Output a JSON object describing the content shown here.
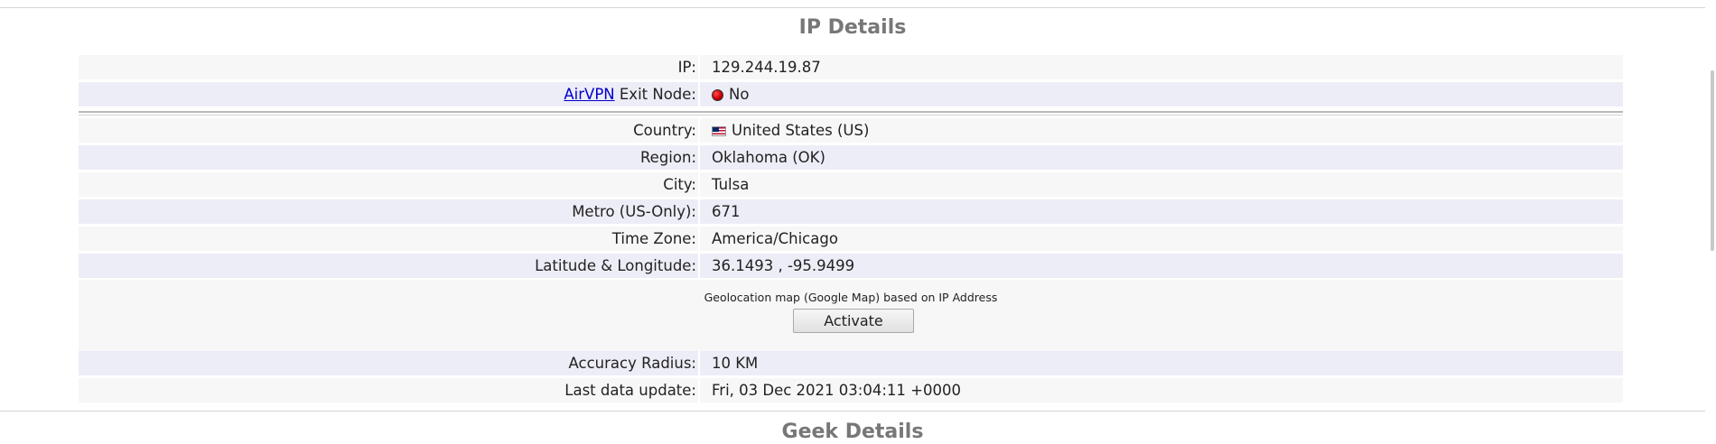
{
  "sections": {
    "ip_details_title": "IP Details",
    "geek_details_title": "Geek Details"
  },
  "rows": {
    "ip": {
      "label": "IP:",
      "value": "129.244.19.87"
    },
    "exit_node": {
      "link": "AirVPN",
      "label": " Exit Node:",
      "value": "No",
      "status_icon": "red-dot-icon"
    },
    "country": {
      "label": "Country:",
      "value": "United States (US)",
      "flag_icon": "us-flag-icon"
    },
    "region": {
      "label": "Region:",
      "value": "Oklahoma (OK)"
    },
    "city": {
      "label": "City:",
      "value": "Tulsa"
    },
    "metro": {
      "label": "Metro (US-Only):",
      "value": "671"
    },
    "timezone": {
      "label": "Time Zone:",
      "value": "America/Chicago"
    },
    "latlong": {
      "label": "Latitude & Longitude:",
      "value": "36.1493 , -95.9499"
    },
    "accuracy": {
      "label": "Accuracy Radius:",
      "value": "10 KM"
    },
    "last_update": {
      "label": "Last data update:",
      "value": "Fri, 03 Dec 2021 03:04:11 +0000"
    }
  },
  "map": {
    "caption": "Geolocation map (Google Map) based on IP Address",
    "button_label": "Activate"
  },
  "colors": {
    "row_light": "#f7f7f7",
    "row_alt": "#ededf7",
    "link": "#0000cc",
    "title": "#777777"
  }
}
